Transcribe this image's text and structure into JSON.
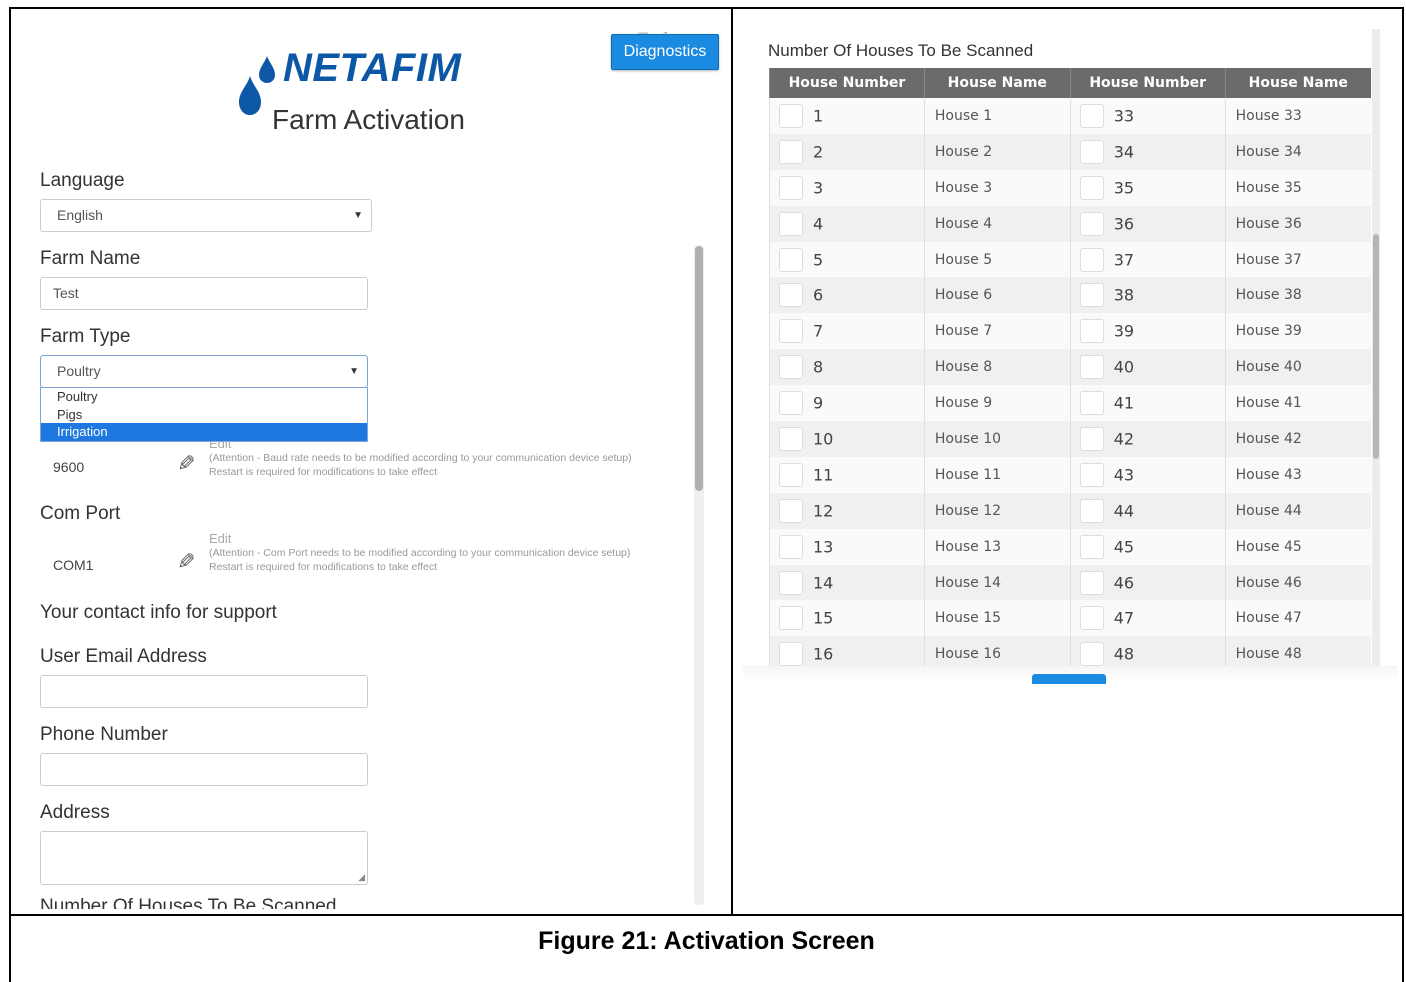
{
  "left": {
    "brand": "NETAFIM",
    "app_title": "Farm Activation",
    "diagnostics_label": "Diagnostics",
    "language": {
      "label": "Language",
      "value": "English"
    },
    "farm_name": {
      "label": "Farm Name",
      "value": "Test"
    },
    "farm_type": {
      "label": "Farm Type",
      "value": "Poultry",
      "options": [
        "Poultry",
        "Pigs",
        "Irrigation"
      ],
      "highlighted": "Irrigation"
    },
    "baud_rate": {
      "value": "9600",
      "edit_label": "Edit",
      "attention": "(Attention - Baud rate needs to be modified according to your communication device setup)",
      "restart": "Restart is required for modifications to take effect"
    },
    "com_port": {
      "label": "Com Port",
      "value": "COM1",
      "edit_label": "Edit",
      "attention": "(Attention - Com Port needs to be modified according to your communication device setup)",
      "restart": "Restart is required for modifications to take effect"
    },
    "contact_heading": "Your contact info for support",
    "email": {
      "label": "User Email Address",
      "value": ""
    },
    "phone": {
      "label": "Phone Number",
      "value": ""
    },
    "address": {
      "label": "Address",
      "value": ""
    },
    "cutoff_label": "Number Of Houses To Be Scanned"
  },
  "right": {
    "title": "Number Of Houses To Be Scanned",
    "headers": [
      "House Number",
      "House Name",
      "House Number",
      "House Name"
    ],
    "rows": [
      {
        "n1": "1",
        "h1": "House 1",
        "n2": "33",
        "h2": "House 33"
      },
      {
        "n1": "2",
        "h1": "House 2",
        "n2": "34",
        "h2": "House 34"
      },
      {
        "n1": "3",
        "h1": "House 3",
        "n2": "35",
        "h2": "House 35"
      },
      {
        "n1": "4",
        "h1": "House 4",
        "n2": "36",
        "h2": "House 36"
      },
      {
        "n1": "5",
        "h1": "House 5",
        "n2": "37",
        "h2": "House 37"
      },
      {
        "n1": "6",
        "h1": "House 6",
        "n2": "38",
        "h2": "House 38"
      },
      {
        "n1": "7",
        "h1": "House 7",
        "n2": "39",
        "h2": "House 39"
      },
      {
        "n1": "8",
        "h1": "House 8",
        "n2": "40",
        "h2": "House 40"
      },
      {
        "n1": "9",
        "h1": "House 9",
        "n2": "41",
        "h2": "House 41"
      },
      {
        "n1": "10",
        "h1": "House 10",
        "n2": "42",
        "h2": "House 42"
      },
      {
        "n1": "11",
        "h1": "House 11",
        "n2": "43",
        "h2": "House 43"
      },
      {
        "n1": "12",
        "h1": "House 12",
        "n2": "44",
        "h2": "House 44"
      },
      {
        "n1": "13",
        "h1": "House 13",
        "n2": "45",
        "h2": "House 45"
      },
      {
        "n1": "14",
        "h1": "House 14",
        "n2": "46",
        "h2": "House 46"
      },
      {
        "n1": "15",
        "h1": "House 15",
        "n2": "47",
        "h2": "House 47"
      },
      {
        "n1": "16",
        "h1": "House 16",
        "n2": "48",
        "h2": "House 48"
      }
    ]
  },
  "caption": "Figure 21: Activation Screen",
  "colors": {
    "brand": "#0d58a6",
    "accent": "#1a8be0",
    "header_bg": "#6b6b6b"
  }
}
